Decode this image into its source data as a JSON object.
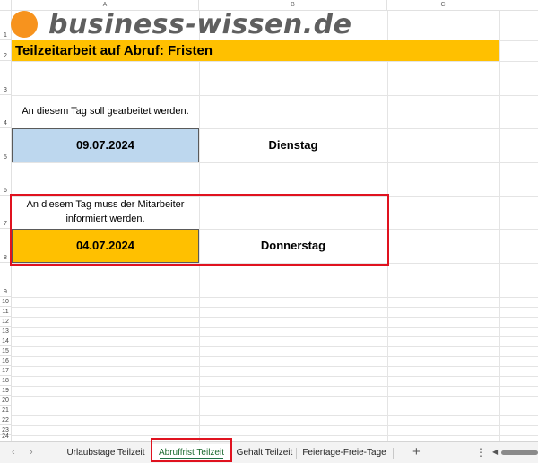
{
  "columns": [
    "A",
    "B",
    "C"
  ],
  "rows": [
    "1",
    "2",
    "3",
    "4",
    "5",
    "6",
    "7",
    "8",
    "9",
    "10",
    "11",
    "12",
    "13",
    "14",
    "15",
    "16",
    "17",
    "18",
    "19",
    "20",
    "21",
    "22",
    "23",
    "24"
  ],
  "logo": {
    "text": "business-wissen.de",
    "circle_color": "#f7931e",
    "text_color": "#5f5f5f"
  },
  "title": {
    "text": "Teilzeitarbeit auf Abruf: Fristen",
    "fill_color": "#ffc000"
  },
  "work_day": {
    "label": "An diesem Tag soll gearbeitet werden.",
    "date": "09.07.2024",
    "weekday": "Dienstag",
    "fill_color": "#bdd7ee"
  },
  "notice_day": {
    "label": "An diesem Tag muss der Mitarbeiter informiert werden.",
    "date": "04.07.2024",
    "weekday": "Donnerstag",
    "fill_color": "#ffc000",
    "highlight_color": "#e0121f"
  },
  "tabs": [
    {
      "label": "Urlaubstage Teilzeit",
      "active": false
    },
    {
      "label": "Abruffrist Teilzeit",
      "active": true
    },
    {
      "label": "Gehalt Teilzeit",
      "active": false
    },
    {
      "label": "Feiertage-Freie-Tage",
      "active": false
    }
  ],
  "tabbar": {
    "prev_icon": "chevron-left-icon",
    "next_icon": "chevron-right-icon",
    "add_icon": "plus-icon",
    "more_icon": "vertical-dots-icon",
    "accent_color": "#1e7145"
  }
}
